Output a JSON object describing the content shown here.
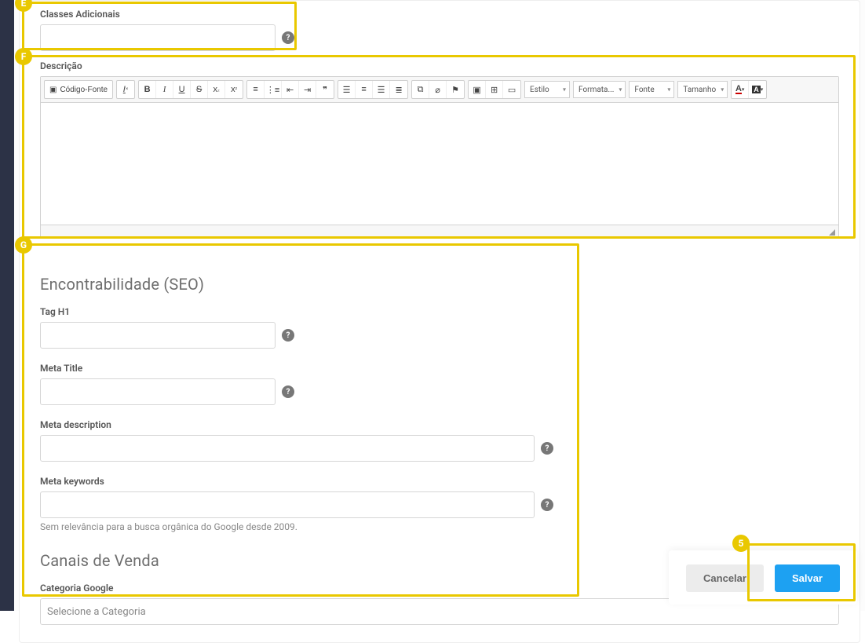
{
  "fields": {
    "classes_adicionais": {
      "label": "Classes Adicionais",
      "value": ""
    },
    "descricao": {
      "label": "Descrição"
    },
    "tag_h1": {
      "label": "Tag H1",
      "value": ""
    },
    "meta_title": {
      "label": "Meta Title",
      "value": ""
    },
    "meta_description": {
      "label": "Meta description",
      "value": ""
    },
    "meta_keywords": {
      "label": "Meta keywords",
      "value": "",
      "hint": "Sem relevância para a busca orgânica do Google desde 2009."
    },
    "categoria_google": {
      "label": "Categoria Google",
      "placeholder": "Selecione a Categoria"
    }
  },
  "sections": {
    "seo_heading": "Encontrabilidade (SEO)",
    "canais_heading": "Canais de Venda"
  },
  "rte_toolbar": {
    "source": "Código-Fonte",
    "style": "Estilo",
    "format": "Formata...",
    "font": "Fonte",
    "size": "Tamanho"
  },
  "buttons": {
    "cancel": "Cancelar",
    "save": "Salvar"
  },
  "annotations": {
    "e": "E",
    "f": "F",
    "g": "G",
    "five": "5"
  }
}
